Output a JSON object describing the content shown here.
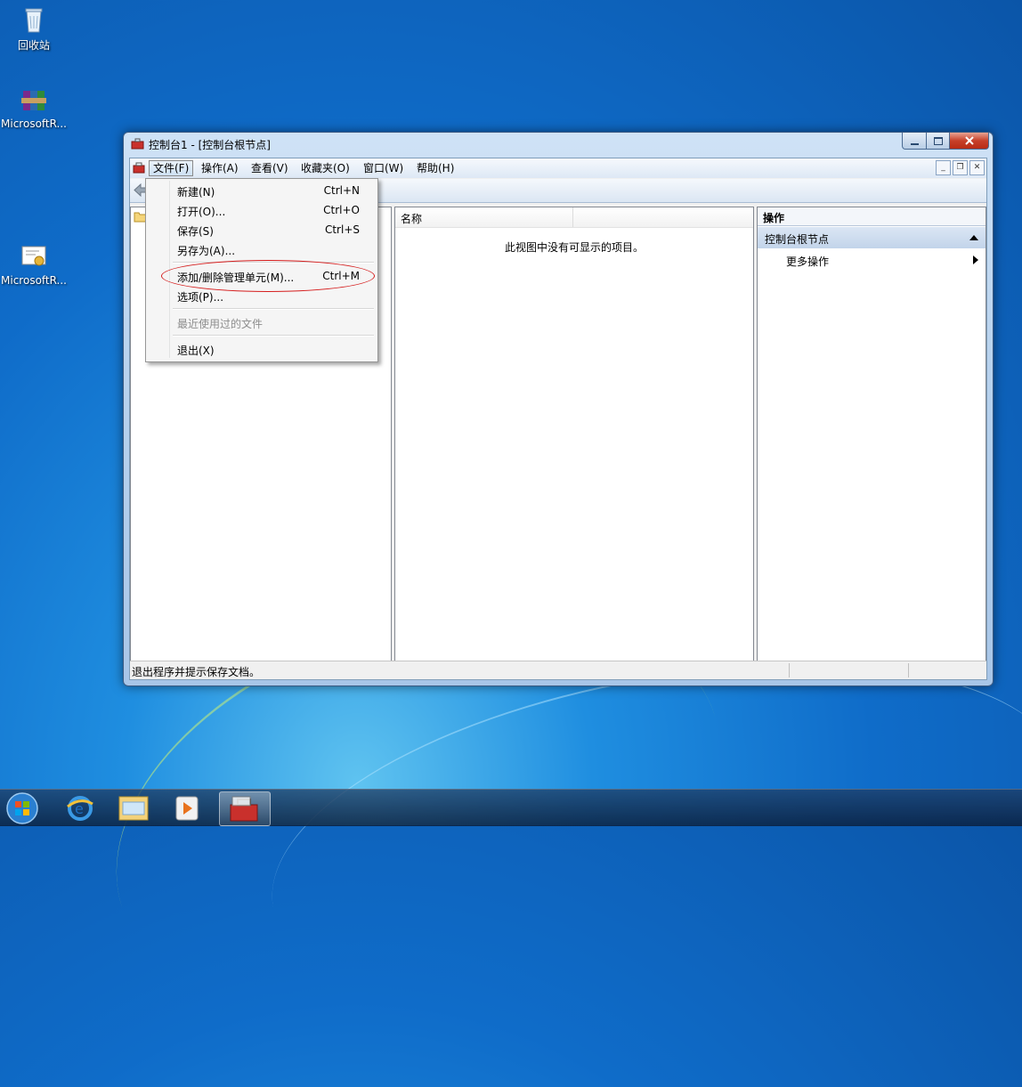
{
  "desktop": {
    "icons": [
      {
        "label": "回收站"
      },
      {
        "label": "MicrosoftR..."
      },
      {
        "label": "MicrosoftR..."
      }
    ]
  },
  "window": {
    "title": "控制台1 - [控制台根节点]",
    "menu": [
      {
        "label": "文件(F)"
      },
      {
        "label": "操作(A)"
      },
      {
        "label": "查看(V)"
      },
      {
        "label": "收藏夹(O)"
      },
      {
        "label": "窗口(W)"
      },
      {
        "label": "帮助(H)"
      }
    ],
    "list": {
      "column_name": "名称",
      "empty_message": "此视图中没有可显示的项目。"
    },
    "actions": {
      "header": "操作",
      "node": "控制台根节点",
      "more": "更多操作"
    },
    "status": "退出程序并提示保存文档。"
  },
  "file_menu": {
    "items": [
      {
        "label": "新建(N)",
        "accel": "Ctrl+N"
      },
      {
        "label": "打开(O)...",
        "accel": "Ctrl+O"
      },
      {
        "label": "保存(S)",
        "accel": "Ctrl+S"
      },
      {
        "label": "另存为(A)...",
        "accel": ""
      },
      {
        "label": "添加/删除管理单元(M)...",
        "accel": "Ctrl+M"
      },
      {
        "label": "选项(P)...",
        "accel": ""
      },
      {
        "label": "最近使用过的文件",
        "accel": ""
      },
      {
        "label": "退出(X)",
        "accel": ""
      }
    ]
  },
  "colors": {
    "highlight_oval": "#d51c1c",
    "desktop_blue": "#0f6cc9"
  }
}
